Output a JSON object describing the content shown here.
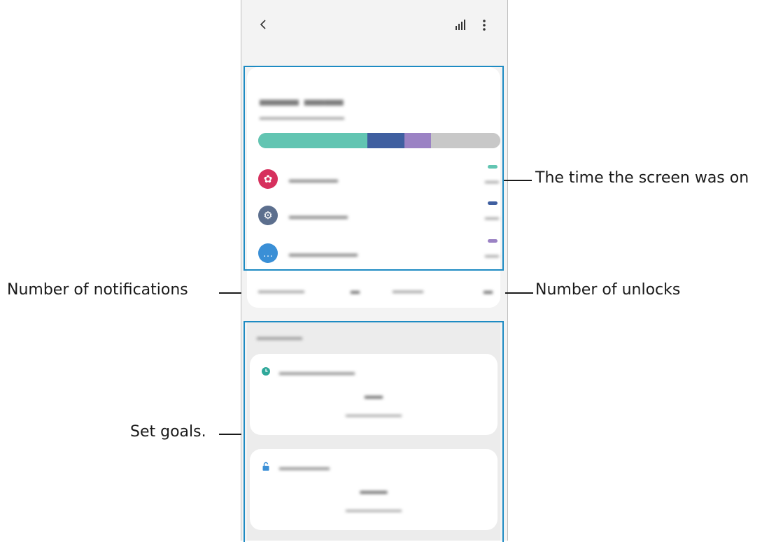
{
  "annotations": {
    "screen_time": "The time the screen was on",
    "notifications": "Number of notifications",
    "unlocks": "Number of unlocks",
    "goals": "Set goals."
  },
  "icons": {
    "back": "chevron-left-icon",
    "bars": "bar-chart-icon",
    "more": "more-vertical-icon"
  },
  "usage_bar": {
    "segments": [
      {
        "color": "#62c5b2",
        "fraction": 0.45
      },
      {
        "color": "#3f5fa0",
        "fraction": 0.155
      },
      {
        "color": "#9b82c4",
        "fraction": 0.11
      },
      {
        "color": "#c8c8c8",
        "fraction": 0.285
      }
    ]
  },
  "apps": [
    {
      "icon": "flower-icon",
      "color": "#d6305d",
      "dash_color": "#62c5b2"
    },
    {
      "icon": "gear-icon",
      "color": "#5c6f8e",
      "dash_color": "#3f5fa0"
    },
    {
      "icon": "chat-icon",
      "color": "#3a8fd6",
      "dash_color": "#9b82c4"
    }
  ],
  "goals": [
    {
      "icon": "clock-icon",
      "icon_color": "#2fa89a"
    },
    {
      "icon": "lock-icon",
      "icon_color": "#3a8fd6"
    }
  ],
  "colors": {
    "highlight": "#1e8bc3"
  }
}
